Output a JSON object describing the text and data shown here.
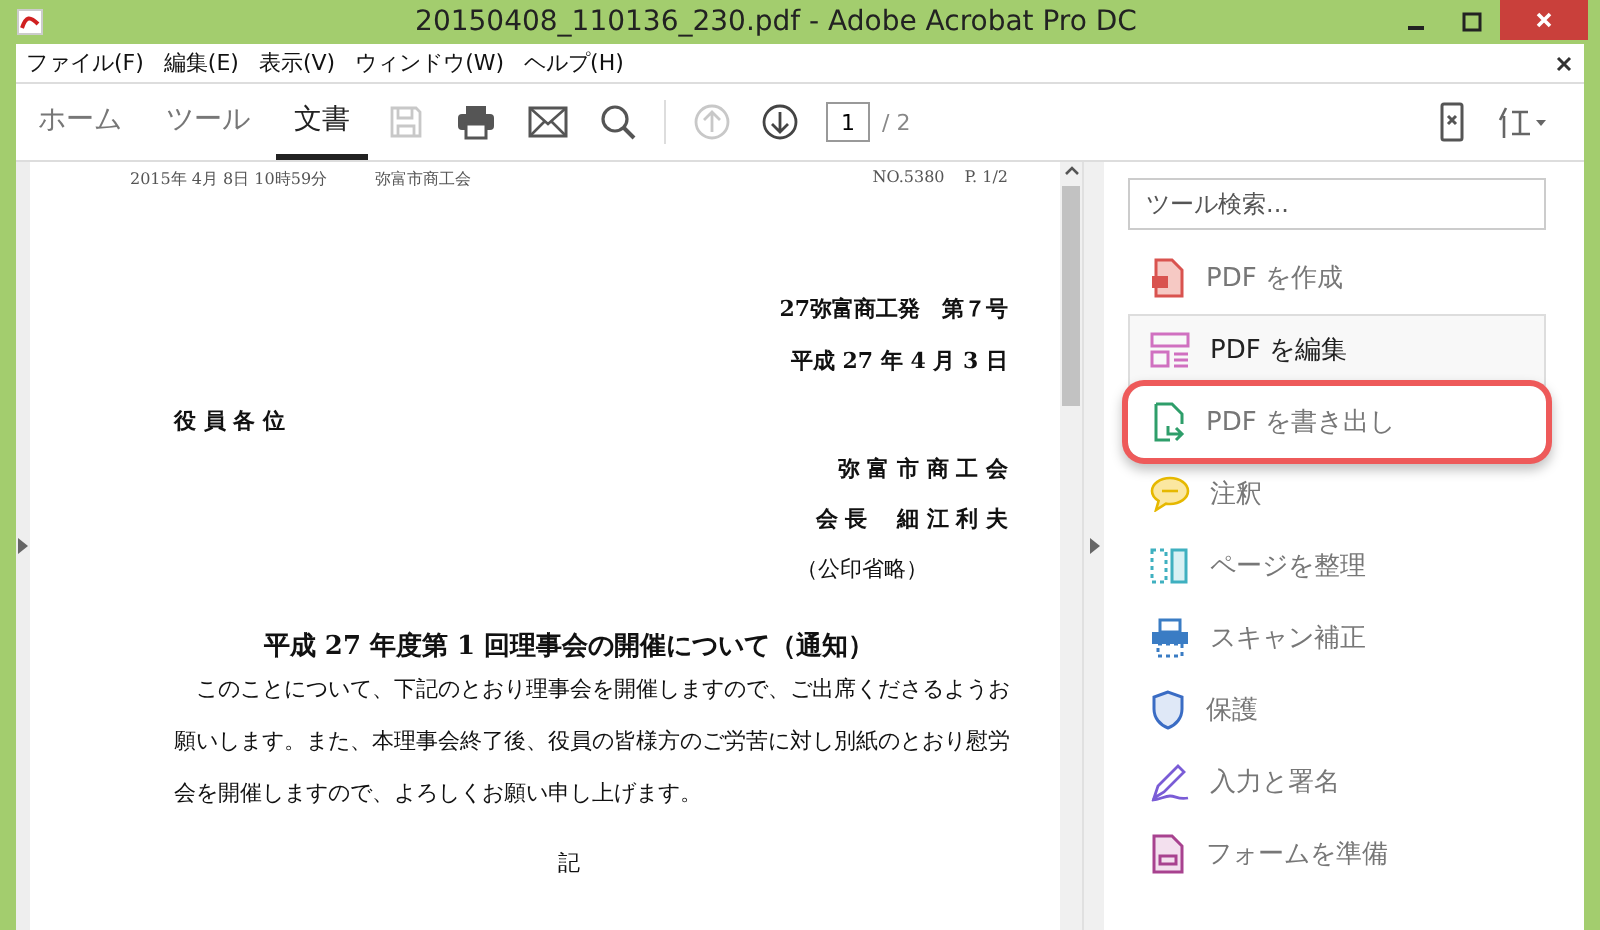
{
  "window": {
    "title": "20150408_110136_230.pdf - Adobe Acrobat Pro DC"
  },
  "menu": [
    "ファイル(F)",
    "編集(E)",
    "表示(V)",
    "ウィンドウ(W)",
    "ヘルプ(H)"
  ],
  "tabs": [
    {
      "label": "ホーム",
      "selected": false
    },
    {
      "label": "ツール",
      "selected": false
    },
    {
      "label": "文書",
      "selected": true
    }
  ],
  "toolbar": {
    "save_disabled": true,
    "prev_disabled": true,
    "page": "1",
    "page_total": "/ 2"
  },
  "document": {
    "header": [
      "2015年 4月 8日 10時59分",
      "弥富市商工会",
      "NO.5380",
      "P. 1/2"
    ],
    "right_lines": [
      "27弥富商工発　第７号",
      "平成 27 年 4 月 3 日"
    ],
    "addressee": "役 員 各 位",
    "sender": [
      "弥 富 市 商 工 会",
      "会 長　 細 江 利 夫"
    ],
    "seal_note": "（公印省略）",
    "title": "平成 27 年度第 1 回理事会の開催について（通知）",
    "body": "このことについて、下記のとおり理事会を開催しますので、ご出席くださるようお願いします。また、本理事会終了後、役員の皆様方のご労苦に対し別紙のとおり慰労会を開催しますので、よろしくお願い申し上げます。",
    "note_mark": "記"
  },
  "tools": {
    "search_placeholder": "ツール検索...",
    "items": [
      {
        "label": "PDF を作成",
        "kind": "create",
        "selected": false,
        "highlighted": false
      },
      {
        "label": "PDF を編集",
        "kind": "edit",
        "selected": true,
        "highlighted": false
      },
      {
        "label": "PDF を書き出し",
        "kind": "export",
        "selected": false,
        "highlighted": true
      },
      {
        "label": "注釈",
        "kind": "comment",
        "selected": false,
        "highlighted": false
      },
      {
        "label": "ページを整理",
        "kind": "organize",
        "selected": false,
        "highlighted": false
      },
      {
        "label": "スキャン補正",
        "kind": "scan",
        "selected": false,
        "highlighted": false
      },
      {
        "label": "保護",
        "kind": "protect",
        "selected": false,
        "highlighted": false
      },
      {
        "label": "入力と署名",
        "kind": "sign",
        "selected": false,
        "highlighted": false
      },
      {
        "label": "フォームを準備",
        "kind": "form",
        "selected": false,
        "highlighted": false
      }
    ]
  }
}
